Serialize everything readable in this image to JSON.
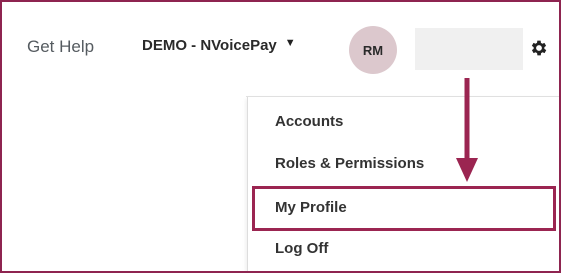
{
  "header": {
    "get_help": "Get Help",
    "org_name": "DEMO - NVoicePay",
    "org_caret": "▼",
    "avatar_initials": "RM",
    "settings_icon": "gear-icon"
  },
  "menu": {
    "items": [
      {
        "label": "Accounts"
      },
      {
        "label": "Roles & Permissions"
      },
      {
        "label": "My Profile"
      },
      {
        "label": "Log Off"
      }
    ]
  },
  "annotation": {
    "arrow_color": "#9b2551",
    "highlight_color": "#9b2551",
    "highlighted_item": "My Profile"
  }
}
